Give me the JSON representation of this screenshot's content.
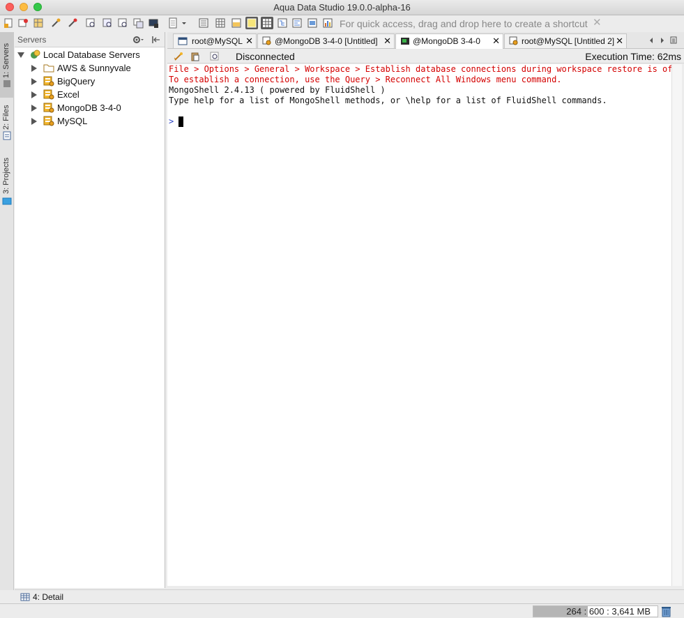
{
  "window": {
    "title": "Aqua Data Studio 19.0.0-alpha-16"
  },
  "toolbar": {
    "shortcut_hint": "For quick access, drag and drop here to create a shortcut"
  },
  "side_tabs": [
    "1: Servers",
    "2: Files",
    "3: Projects"
  ],
  "server_panel": {
    "title": "Servers",
    "root": "Local Database Servers",
    "items": [
      {
        "label": "AWS & Sunnyvale",
        "icon": "folder-icon"
      },
      {
        "label": "BigQuery",
        "icon": "database-server-icon"
      },
      {
        "label": "Excel",
        "icon": "database-server-icon"
      },
      {
        "label": "MongoDB 3-4-0",
        "icon": "database-server-icon"
      },
      {
        "label": "MySQL",
        "icon": "database-server-icon"
      }
    ]
  },
  "editor_tabs": [
    {
      "label": "root@MySQL"
    },
    {
      "label": "@MongoDB 3-4-0 [Untitled]"
    },
    {
      "label": "@MongoDB 3-4-0",
      "active": true
    },
    {
      "label": "root@MySQL [Untitled 2]"
    }
  ],
  "editor_toolbar": {
    "status": "Disconnected",
    "execution_time": "Execution Time: 62ms"
  },
  "console": {
    "lines": [
      {
        "text": "File > Options > General > Workspace > Establish database connections during workspace restore is off.",
        "kind": "error"
      },
      {
        "text": "To establish a connection, use the Query > Reconnect All Windows menu command.",
        "kind": "error"
      },
      {
        "text": "MongoShell 2.4.13 ( powered by FluidShell )",
        "kind": "info"
      },
      {
        "text": "Type help for a list of MongoShell methods, or \\help for a list of FluidShell commands.",
        "kind": "info"
      }
    ],
    "prompt": ">"
  },
  "detail_bar": {
    "label": "4: Detail"
  },
  "status_bar": {
    "memory": "264 : 600 : 3,641 MB",
    "memory_fraction": 0.44
  },
  "colors": {
    "error": "#d40000",
    "prompt": "#2a43c6",
    "folder": "#d9a441",
    "server": "#e2a92a"
  }
}
